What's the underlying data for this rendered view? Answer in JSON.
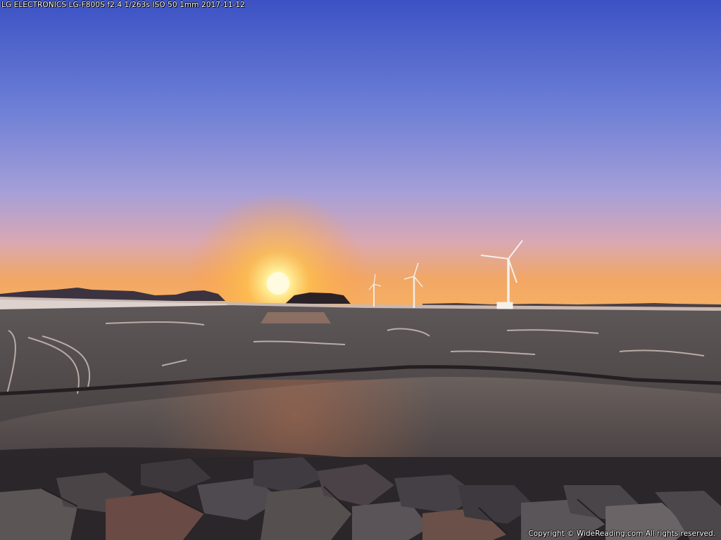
{
  "overlay": {
    "exif_text": "LG ELECTRONICS LG-F800S  f2.4  1/263s ISO 50 1mm 2017-11-12",
    "copyright_text": "Copyright © WideReading.com All rights reserved."
  },
  "colors": {
    "sky_top": "#3f55c6",
    "sky_mid": "#9a96d8",
    "sky_horizon": "#f3a85a",
    "sun": "#fff6b0",
    "mudflat": "#4a4646",
    "rocks": "#2c2a2e"
  }
}
